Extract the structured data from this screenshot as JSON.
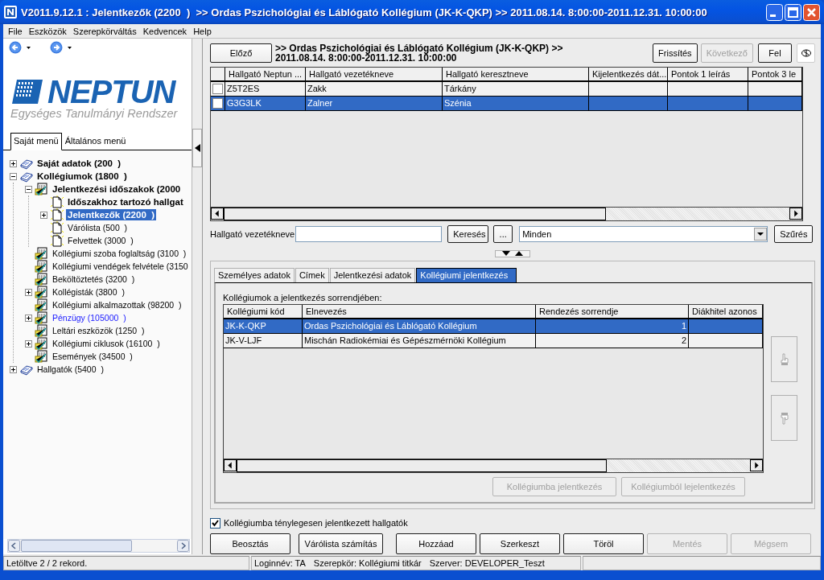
{
  "window": {
    "title": "V2011.9.12.1 : Jelentkezők (2200  )  >> Ordas Pszichológiai és Láblógató Kollégium (JK-K-QKP) >> 2011.08.14. 8:00:00-2011.12.31. 10:00:00"
  },
  "menu": [
    "File",
    "Eszközök",
    "Szerepkörváltás",
    "Kedvencek",
    "Help"
  ],
  "logo": {
    "name": "NEPTUN",
    "subtitle": "Egységes Tanulmányi Rendszer"
  },
  "sidebar_tabs": [
    {
      "label": "Saját menü",
      "selected": true
    },
    {
      "label": "Általános menü",
      "selected": false
    }
  ],
  "tree": [
    {
      "label": "Saját adatok (200  )",
      "kind": "book",
      "bold": true,
      "expandable": true,
      "expanded": false,
      "selected": false,
      "accent": false
    },
    {
      "label": "Kollégiumok (1800  )",
      "kind": "book",
      "bold": true,
      "expandable": true,
      "expanded": true,
      "selected": false,
      "accent": false,
      "children": [
        {
          "label": "Jelentkezési időszakok (2000",
          "kind": "form",
          "bold": true,
          "expandable": true,
          "expanded": true,
          "selected": false,
          "accent": false,
          "children": [
            {
              "label": "Időszakhoz tartozó hallgat",
              "kind": "page",
              "bold": true,
              "expandable": false,
              "selected": false,
              "accent": false
            },
            {
              "label": "Jelentkezők (2200  )",
              "kind": "page",
              "bold": true,
              "expandable": true,
              "expanded": false,
              "selected": true,
              "accent": false
            },
            {
              "label": "Várólista (500  )",
              "kind": "page",
              "bold": false,
              "expandable": false,
              "selected": false,
              "accent": false
            },
            {
              "label": "Felvettek (3000  )",
              "kind": "page",
              "bold": false,
              "expandable": false,
              "selected": false,
              "accent": false
            }
          ]
        },
        {
          "label": "Kollégiumi szoba foglaltság (3100  )",
          "kind": "form",
          "bold": false,
          "expandable": false,
          "selected": false,
          "accent": false
        },
        {
          "label": "Kollégiumi vendégek felvétele (3150",
          "kind": "form",
          "bold": false,
          "expandable": false,
          "selected": false,
          "accent": false
        },
        {
          "label": "Beköltöztetés (3200  )",
          "kind": "form",
          "bold": false,
          "expandable": false,
          "selected": false,
          "accent": false
        },
        {
          "label": "Kollégisták (3800  )",
          "kind": "form",
          "bold": false,
          "expandable": true,
          "expanded": false,
          "selected": false,
          "accent": false
        },
        {
          "label": "Kollégiumi alkalmazottak (98200  )",
          "kind": "form",
          "bold": false,
          "expandable": false,
          "selected": false,
          "accent": false
        },
        {
          "label": "Pénzügy (105000  )",
          "kind": "form",
          "bold": false,
          "expandable": true,
          "expanded": false,
          "selected": false,
          "accent": true
        },
        {
          "label": "Leltári eszközök (1250  )",
          "kind": "form",
          "bold": false,
          "expandable": false,
          "selected": false,
          "accent": false
        },
        {
          "label": "Kollégiumi ciklusok (16100  )",
          "kind": "form",
          "bold": false,
          "expandable": true,
          "expanded": false,
          "selected": false,
          "accent": false
        },
        {
          "label": "Események (34500  )",
          "kind": "form",
          "bold": false,
          "expandable": false,
          "selected": false,
          "accent": false
        }
      ]
    },
    {
      "label": "Hallgatók (5400  )",
      "kind": "book",
      "bold": false,
      "expandable": true,
      "expanded": false,
      "selected": false,
      "accent": false
    }
  ],
  "header": {
    "prev_button": {
      "label": "Előző",
      "disabled": false
    },
    "title_lines": [
      ">> Ordas Pszichológiai és Láblógató Kollégium (JK-K-QKP) >>",
      "2011.08.14. 8:00:00-2011.12.31. 10:00:00"
    ],
    "buttons": [
      {
        "label": "Frissítés",
        "disabled": false
      },
      {
        "label": "Következő",
        "disabled": true
      },
      {
        "label": "Fel",
        "disabled": false
      }
    ]
  },
  "students_table": {
    "columns": [
      "Hallgató Neptun ...",
      "Hallgató vezetékneve",
      "Hallgató keresztneve",
      "Kijelentkezés dát...",
      "Pontok 1 leírás",
      "Pontok 3 le"
    ],
    "rows": [
      {
        "cells": [
          "Z5T2ES",
          "Zakk",
          "Tárkány",
          "",
          "",
          ""
        ],
        "checked": false,
        "selected": false
      },
      {
        "cells": [
          "G3G3LK",
          "Zalner",
          "Szénia",
          "",
          "",
          ""
        ],
        "checked": false,
        "selected": true
      }
    ]
  },
  "search": {
    "label": "Hallgató vezetékneve",
    "search_button": "Keresés",
    "more_button": "...",
    "filter_value": "Minden",
    "filter_button": "Szűrés"
  },
  "detail_tabs": [
    {
      "label": "Személyes adatok",
      "selected": false
    },
    {
      "label": "Címek",
      "selected": false
    },
    {
      "label": "Jelentkezési adatok",
      "selected": false
    },
    {
      "label": "Kollégiumi jelentkezés",
      "selected": true
    }
  ],
  "colleges": {
    "caption": "Kollégiumok a jelentkezés sorrendjében:",
    "columns": [
      "Kollégiumi kód",
      "Elnevezés",
      "Rendezés sorrendje",
      "Diákhitel azonos"
    ],
    "rows": [
      {
        "cells": [
          "JK-K-QKP",
          "Ordas Pszichológiai és Láblógató Kollégium",
          "1",
          ""
        ],
        "selected": true
      },
      {
        "cells": [
          "JK-V-LJF",
          "Mischán Radiokémiai és Gépészmérnöki Kollégium",
          "2",
          ""
        ],
        "selected": false
      }
    ],
    "move_up_disabled": true,
    "move_down_disabled": true,
    "buttons": [
      {
        "label": "Kollégiumba jelentkezés",
        "disabled": true
      },
      {
        "label": "Kollégiumból lejelentkezés",
        "disabled": true
      }
    ]
  },
  "filter_checkbox": {
    "label": "Kollégiumba ténylegesen jelentkezett hallgatók",
    "checked": true
  },
  "actions": [
    {
      "label": "Beosztás",
      "disabled": false
    },
    {
      "label": "Várólista számítás",
      "disabled": false
    },
    {
      "label": "Hozzáad",
      "disabled": false
    },
    {
      "label": "Szerkeszt",
      "disabled": false
    },
    {
      "label": "Töröl",
      "disabled": false
    },
    {
      "label": "Mentés",
      "disabled": true
    },
    {
      "label": "Mégsem",
      "disabled": true
    }
  ],
  "status_bar": [
    "Letöltve 2 / 2 rekord.",
    "Loginnév: TA",
    "Szerepkör: Kollégiumi titkár",
    "Szerver: DEVELOPER_Teszt"
  ]
}
